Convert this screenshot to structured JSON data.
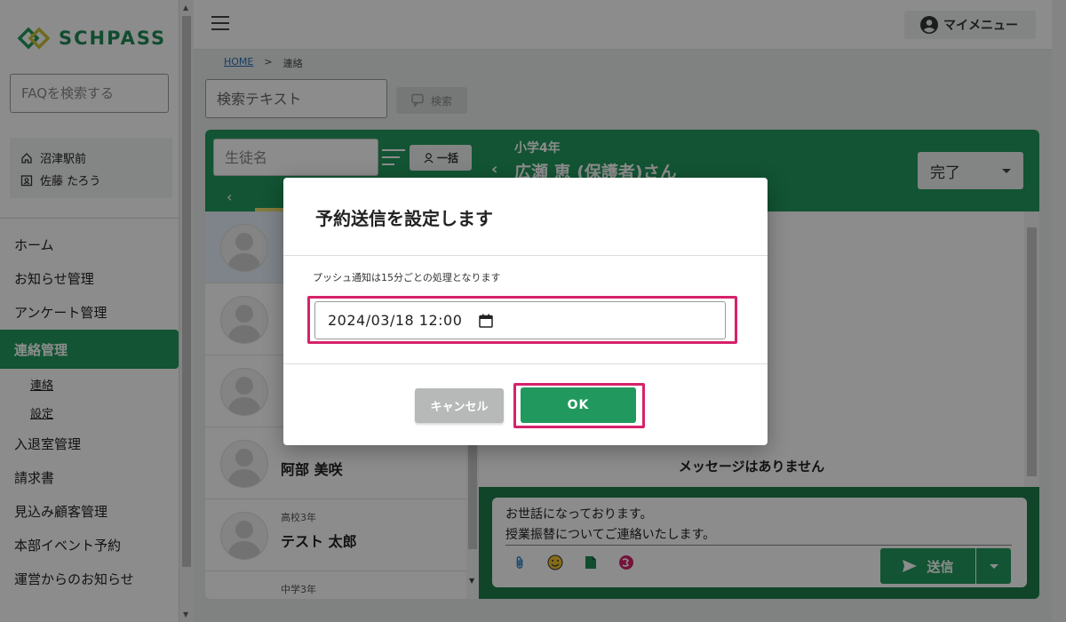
{
  "brand": {
    "logo_text": "SCHPASS",
    "accent": "#21995e"
  },
  "sidebar": {
    "faq_placeholder": "FAQを検索する",
    "school": "沼津駅前",
    "user": "佐藤 たろう",
    "items": [
      {
        "label": "ホーム"
      },
      {
        "label": "お知らせ管理"
      },
      {
        "label": "アンケート管理"
      },
      {
        "label": "連絡管理",
        "active": true
      },
      {
        "label": "入退室管理"
      },
      {
        "label": "請求書"
      },
      {
        "label": "見込み顧客管理"
      },
      {
        "label": "本部イベント予約"
      },
      {
        "label": "運営からのお知らせ"
      }
    ],
    "subitems": [
      {
        "label": "連絡"
      },
      {
        "label": "設定"
      }
    ]
  },
  "topbar": {
    "my_menu": "マイメニュー"
  },
  "breadcrumb": {
    "home": "HOME",
    "separator": ">",
    "current": "連絡"
  },
  "search": {
    "placeholder": "検索テキスト",
    "button": "検索"
  },
  "student_list": {
    "search_placeholder": "生徒名",
    "bulk_button": "一括",
    "students": [
      {
        "grade": "",
        "name": ""
      },
      {
        "grade": "",
        "name": ""
      },
      {
        "grade": "",
        "name": ""
      },
      {
        "grade": "",
        "name": "阿部 美咲"
      },
      {
        "grade": "高校3年",
        "name": "テスト 太郎"
      },
      {
        "grade": "中学3年",
        "name": ""
      }
    ]
  },
  "chat": {
    "grade": "小学4年",
    "recipient": "広瀬 恵 (保護者)さん",
    "status": "完了",
    "no_messages": "メッセージはありません",
    "compose_text": "お世話になっております。\n授業振替についてご連絡いたします。",
    "send_button": "送信"
  },
  "modal": {
    "title": "予約送信を設定します",
    "note": "プッシュ通知は15分ごとの処理となります",
    "datetime_value": "2024/03/18 12:00",
    "cancel": "キャンセル",
    "ok": "OK",
    "highlight_color": "#d6226a"
  }
}
